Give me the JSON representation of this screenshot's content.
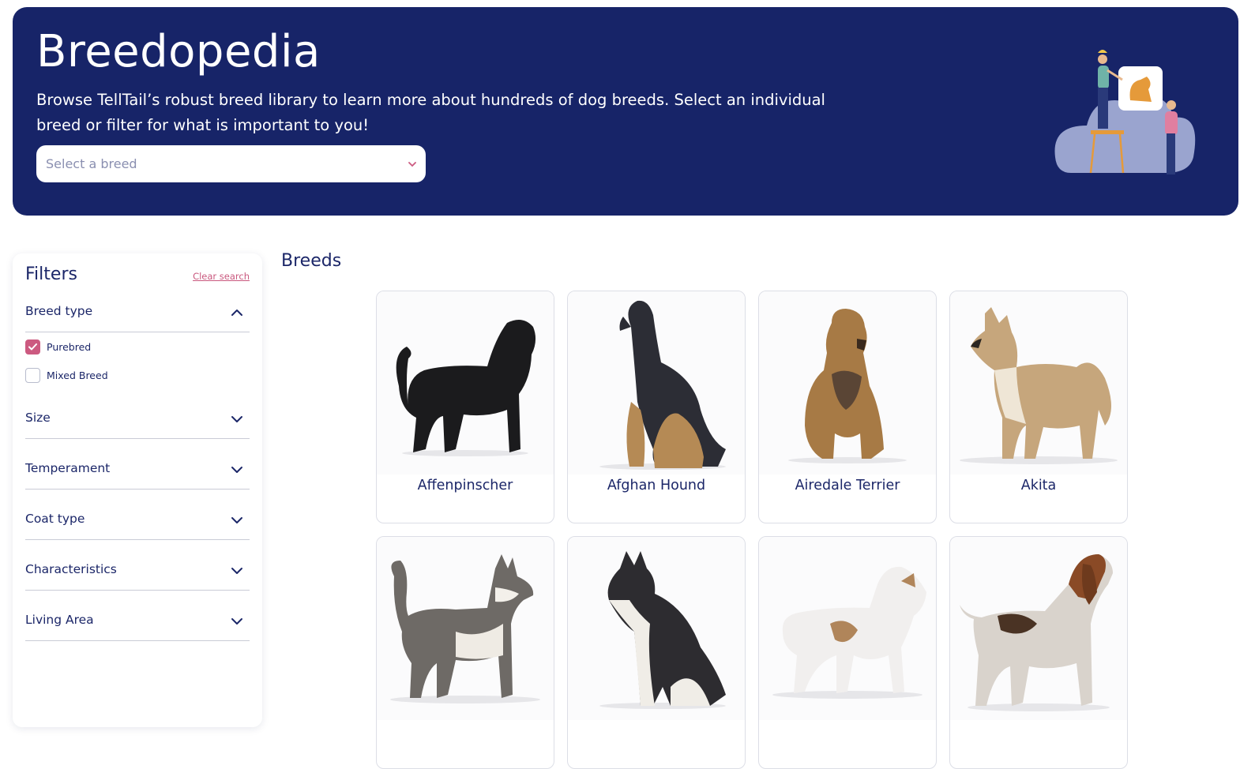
{
  "hero": {
    "title": "Breedopedia",
    "description": "Browse TellTail’s robust breed library to learn more about hundreds of dog breeds. Select an individual breed or filter for what is important to you!",
    "select_placeholder": "Select a breed"
  },
  "filters": {
    "title": "Filters",
    "clear_label": "Clear search",
    "breed_type": {
      "label": "Breed type",
      "expanded": true,
      "options": [
        {
          "label": "Purebred",
          "checked": true
        },
        {
          "label": "Mixed Breed",
          "checked": false
        }
      ]
    },
    "sections": [
      {
        "label": "Size"
      },
      {
        "label": "Temperament"
      },
      {
        "label": "Coat type"
      },
      {
        "label": "Characteristics"
      },
      {
        "label": "Living Area"
      }
    ]
  },
  "breeds": {
    "title": "Breeds",
    "items": [
      {
        "name": "Affenpinscher",
        "icon": "black-dog-photo"
      },
      {
        "name": "Afghan Hound",
        "icon": "afghan-hound-photo"
      },
      {
        "name": "Airedale Terrier",
        "icon": "airedale-terrier-photo"
      },
      {
        "name": "Akita",
        "icon": "akita-photo"
      },
      {
        "name": "",
        "icon": "husky-photo"
      },
      {
        "name": "",
        "icon": "malamute-photo"
      },
      {
        "name": "",
        "icon": "bulldog-photo"
      },
      {
        "name": "",
        "icon": "hound-photo"
      }
    ]
  },
  "colors": {
    "hero_bg": "#172468",
    "accent": "#cc5a80",
    "text": "#1b2668"
  }
}
